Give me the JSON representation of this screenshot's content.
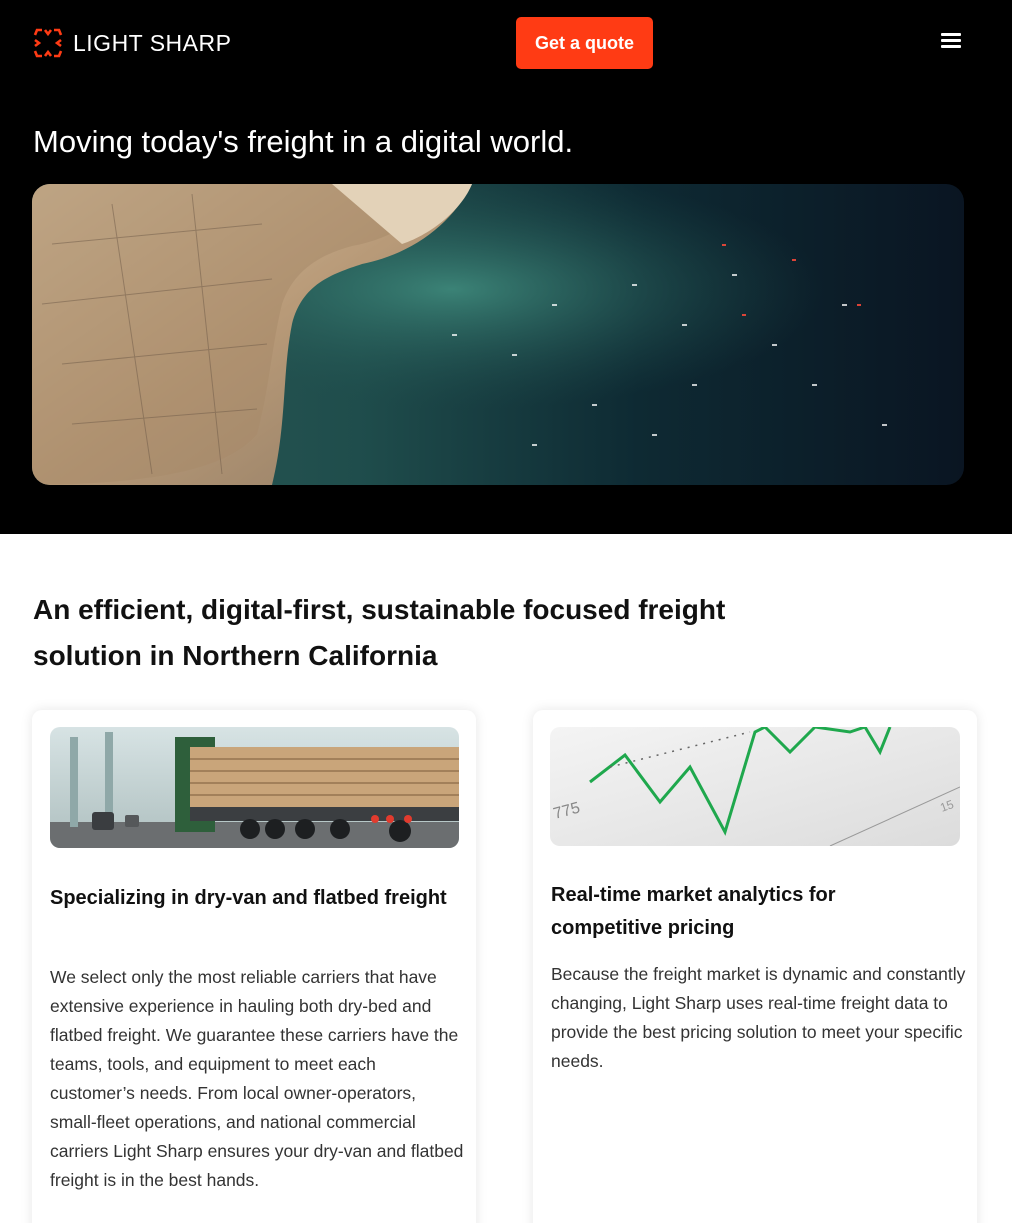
{
  "header": {
    "brand": "LIGHT SHARP",
    "cta_label": "Get a quote",
    "menu_icon": "hamburger-icon",
    "accent_color": "#ff3b14"
  },
  "hero": {
    "title": "Moving today's freight in a digital world.",
    "image": "aerial-port-satellite-image"
  },
  "intro": {
    "heading": "An efficient, digital-first, sustainable focused freight solution in Northern California"
  },
  "cards": [
    {
      "image": "flatbed-truck-lumber-image",
      "title": "Specializing in dry-van and flatbed freight",
      "body": "We select only the most reliable carriers that have extensive experience in hauling both dry-bed and flatbed freight. We guarantee these carriers have the teams, tools, and equipment to meet each customer’s needs.  From local owner-operators, small-fleet operations, and national commercial carriers Light Sharp ensures your dry-van and flatbed freight is in the best hands."
    },
    {
      "image": "market-chart-image",
      "image_labels": [
        "775",
        "15"
      ],
      "title": "Real-time market analytics for competitive pricing",
      "body": "Because the freight market is dynamic and constantly changing, Light Sharp uses real-time freight data to provide the best pricing solution to meet your specific needs."
    }
  ]
}
